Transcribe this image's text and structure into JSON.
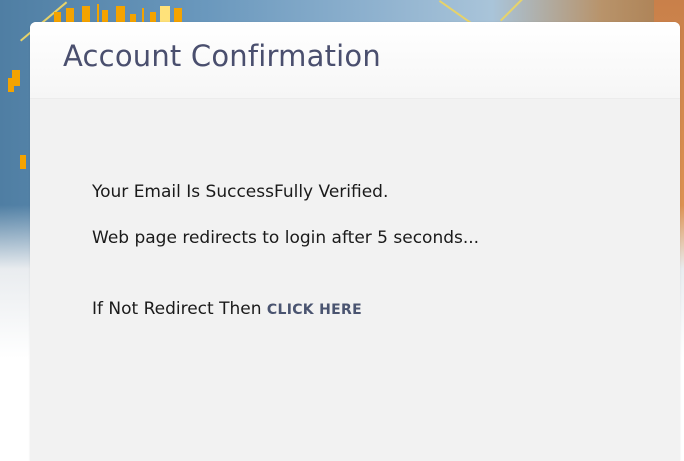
{
  "card": {
    "title": "Account Confirmation",
    "message_verified": "Your Email Is SuccessFully Verified.",
    "message_redirect": "Web page redirects to login after 5 seconds...",
    "fallback_prefix": "If Not Redirect Then",
    "fallback_link": "CLICK HERE"
  },
  "colors": {
    "title": "#4a4f6e",
    "link": "#4a5470",
    "card_background": "#f2f2f2",
    "chart_candle": "#f4a300"
  }
}
